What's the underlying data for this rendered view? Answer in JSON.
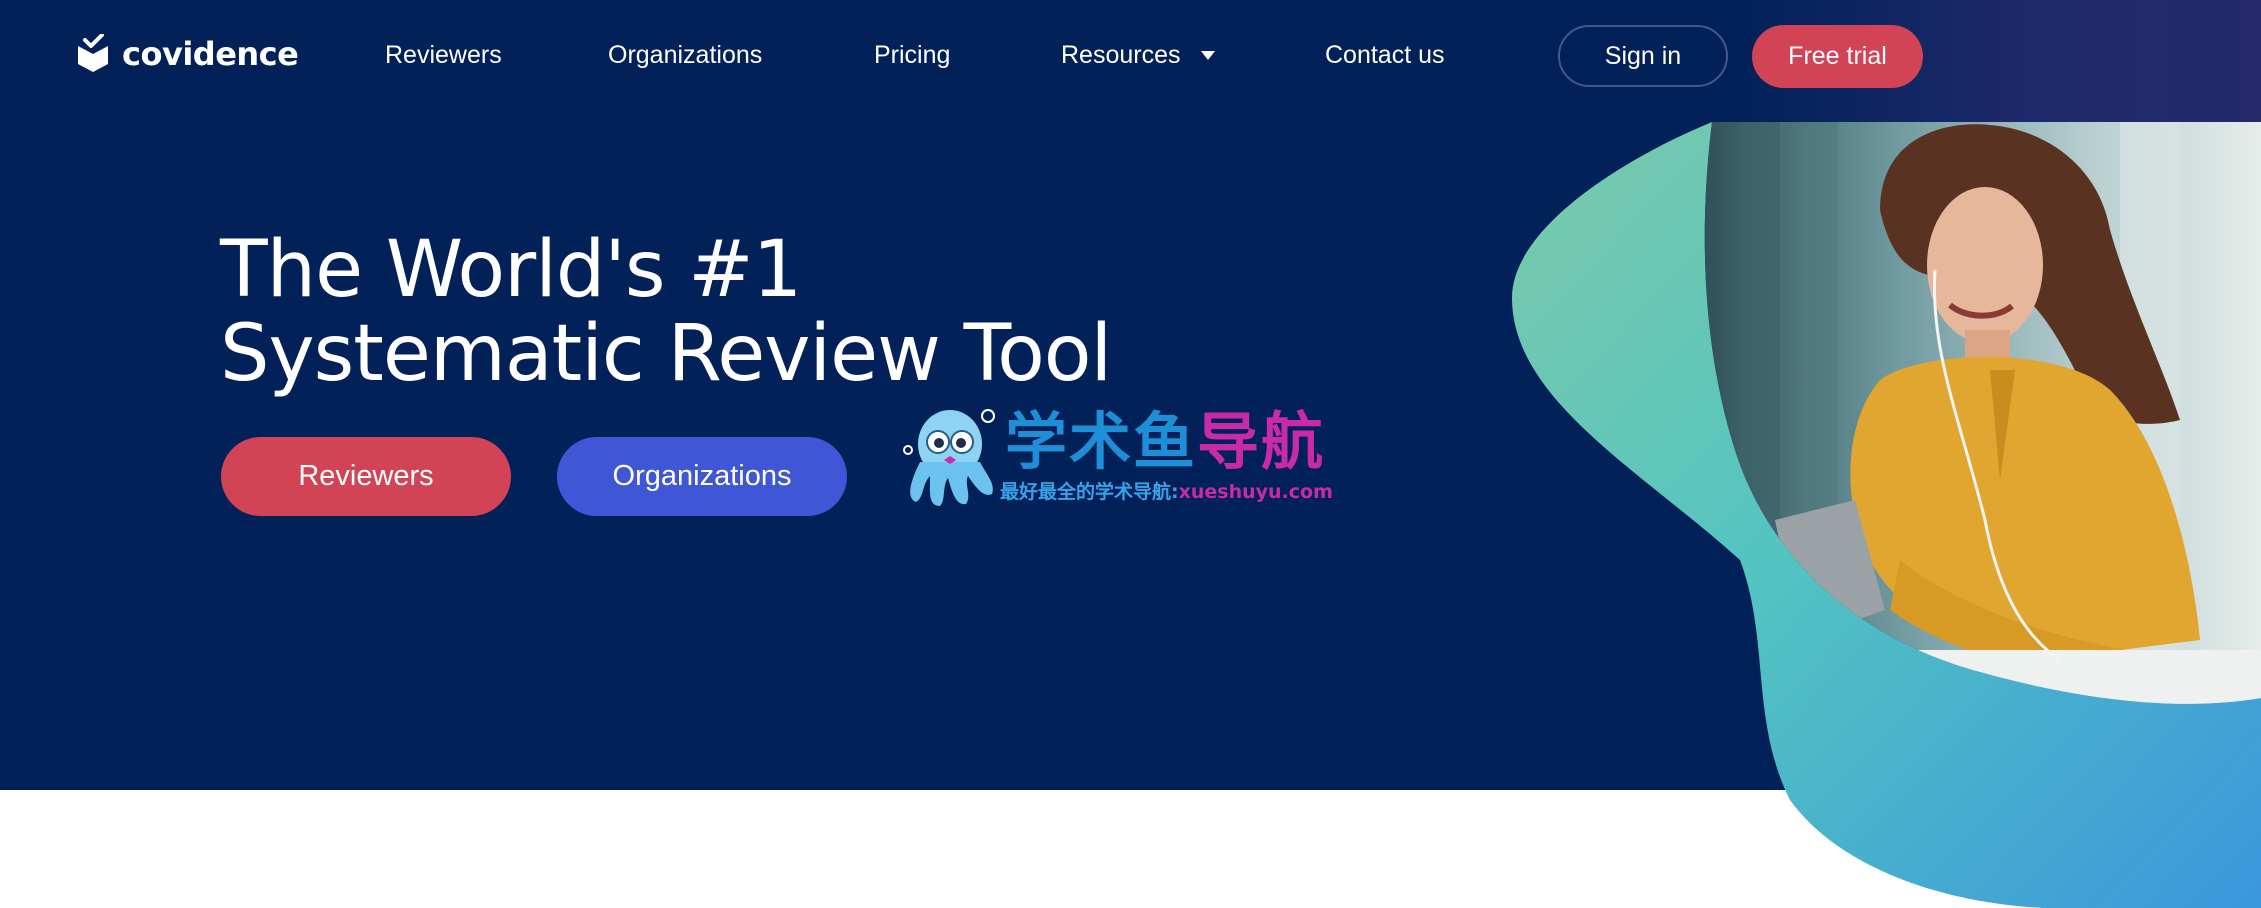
{
  "brand": {
    "name": "covidence",
    "logo_icon": "box-check-icon"
  },
  "nav": {
    "items": [
      {
        "label": "Reviewers"
      },
      {
        "label": "Organizations"
      },
      {
        "label": "Pricing"
      },
      {
        "label": "Resources",
        "icon": "caret-down-icon"
      },
      {
        "label": "Contact us"
      }
    ],
    "sign_in": "Sign in",
    "free_trial": "Free trial"
  },
  "hero": {
    "headline_line1": "The World's #1",
    "headline_line2": "Systematic Review Tool",
    "cta_reviewers": "Reviewers",
    "cta_organizations": "Organizations",
    "image": "woman-with-earphones-photo"
  },
  "watermark": {
    "title_part1": "学术鱼",
    "title_part2": "导航",
    "subtitle": "最好最全的学术导航:",
    "url": "xueshuyu.com",
    "mascot": "octopus-mascot-icon"
  },
  "colors": {
    "hero_bg": "#022159",
    "accent_red": "#d24356",
    "accent_blue": "#3f57d6",
    "blob_teal": "#5ec9b5",
    "blob_blue": "#3d9bd9",
    "purple": "#8e2a8a",
    "shirt_yellow": "#e0a630"
  }
}
